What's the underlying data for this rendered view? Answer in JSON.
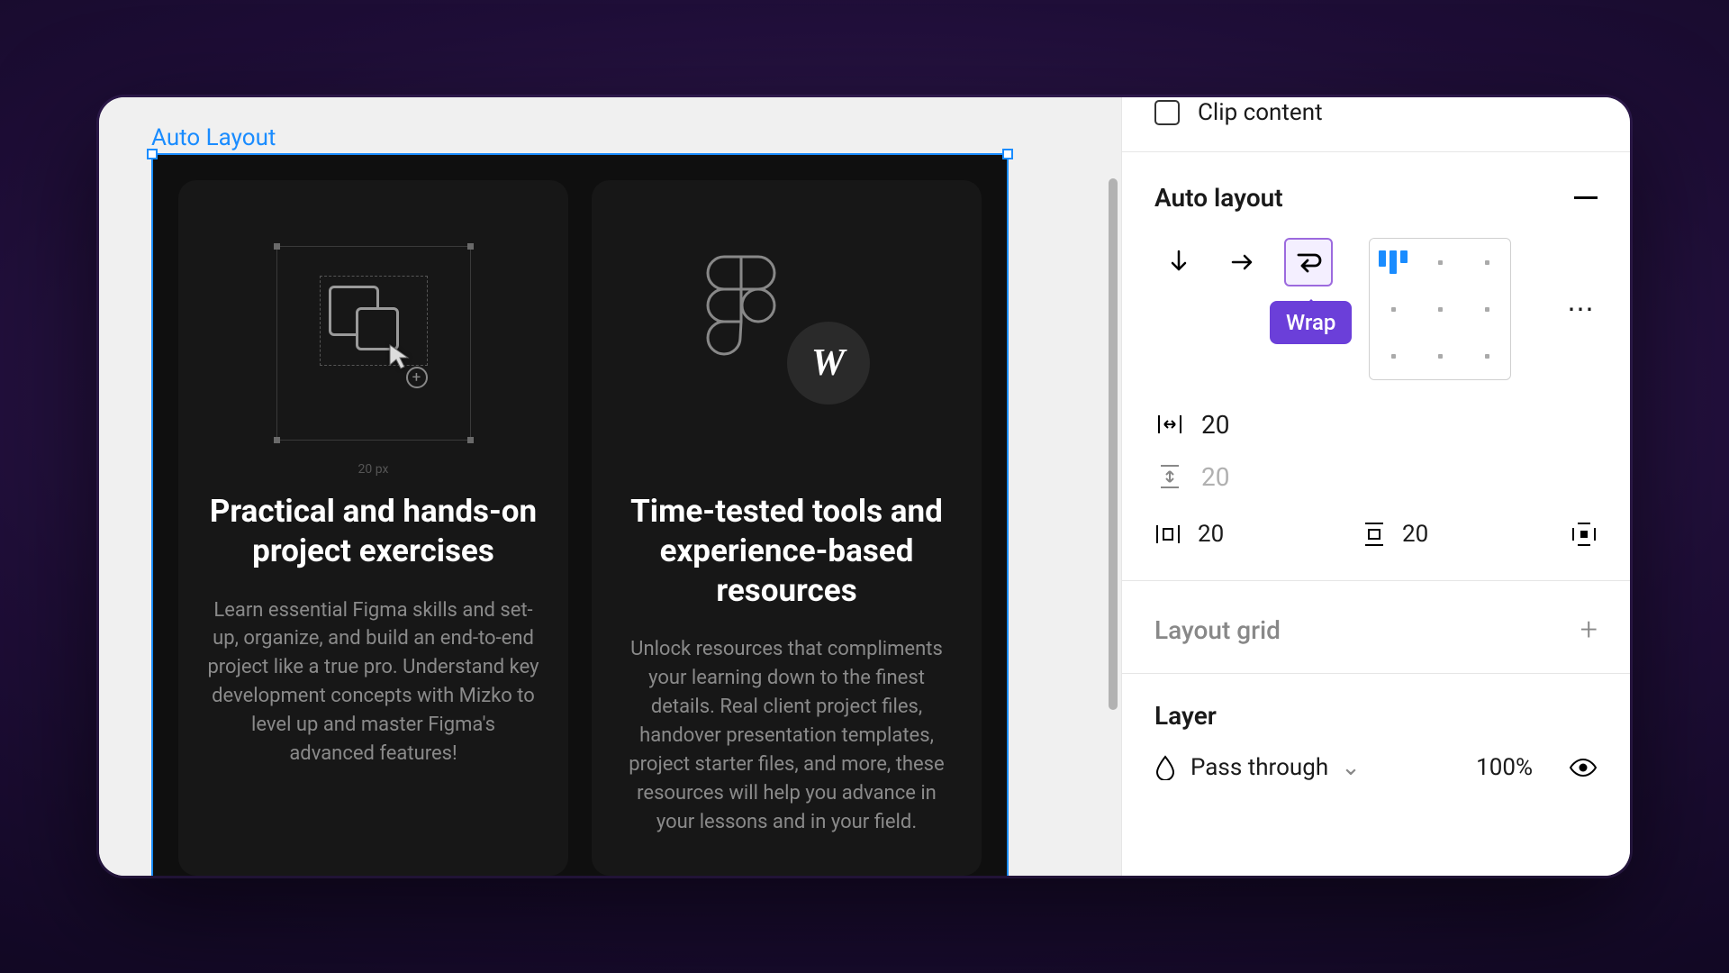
{
  "canvas": {
    "frame_label": "Auto Layout",
    "card1": {
      "title": "Practical and hands-on project exercises",
      "desc": "Learn essential Figma skills and set-up, organize, and build an end-to-end project like a true pro. Understand key development concepts with Mizko to level up and master Figma's advanced features!",
      "dim_label": "20 px"
    },
    "card2": {
      "title": "Time-tested tools and experience-based resources",
      "desc": "Unlock resources that compliments your learning down to the finest details. Real client project files, handover presentation templates, project starter files, and more, these resources will help you advance in your lessons and in your field.",
      "w_letter": "W"
    }
  },
  "panel": {
    "clip_content_label": "Clip content",
    "autolayout_label": "Auto layout",
    "wrap_tooltip": "Wrap",
    "gap_h": "20",
    "gap_v": "20",
    "pad_h": "20",
    "pad_v": "20",
    "layout_grid_label": "Layout grid",
    "layer_label": "Layer",
    "blend_mode": "Pass through",
    "opacity": "100%"
  }
}
